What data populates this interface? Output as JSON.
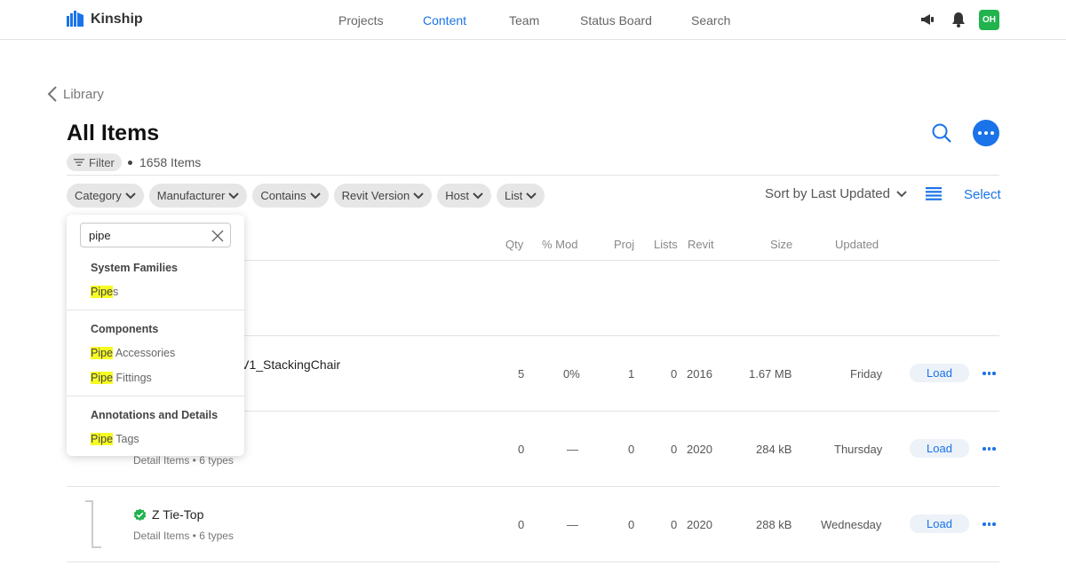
{
  "app": {
    "name": "Kinship"
  },
  "nav": [
    {
      "label": "Projects",
      "active": false
    },
    {
      "label": "Content",
      "active": true
    },
    {
      "label": "Team",
      "active": false
    },
    {
      "label": "Status Board",
      "active": false
    },
    {
      "label": "Search",
      "active": false
    }
  ],
  "user": {
    "initials": "OH",
    "color": "#21b34e"
  },
  "breadcrumb": {
    "back_label": "Library"
  },
  "page": {
    "title": "All Items",
    "filter_label": "Filter",
    "count_text": "1658 Items"
  },
  "chips": [
    "Category",
    "Manufacturer",
    "Contains",
    "Revit Version",
    "Host",
    "List"
  ],
  "sort": {
    "label": "Sort by Last Updated"
  },
  "select_label": "Select",
  "columns": [
    "Qty",
    "% Mod",
    "Proj",
    "Lists",
    "Revit",
    "Size",
    "Updated"
  ],
  "rows": [
    {
      "name": "HV1_StackingChair",
      "subtitle": "",
      "qty": "5",
      "mod": "0%",
      "proj": "1",
      "lists": "0",
      "revit": "2016",
      "size": "1.67 MB",
      "updated": "Friday",
      "action": "Load"
    },
    {
      "name": "",
      "subtitle": "Detail Items • 6 types",
      "qty": "0",
      "mod": "—",
      "proj": "0",
      "lists": "0",
      "revit": "2020",
      "size": "284 kB",
      "updated": "Thursday",
      "action": "Load"
    },
    {
      "name": "Z Tie-Top",
      "subtitle": "Detail Items • 6 types",
      "qty": "0",
      "mod": "—",
      "proj": "0",
      "lists": "0",
      "revit": "2020",
      "size": "288 kB",
      "updated": "Wednesday",
      "action": "Load"
    }
  ],
  "dropdown": {
    "search_value": "pipe",
    "groups": [
      {
        "title": "System Families",
        "options": [
          {
            "match": "Pipe",
            "rest": "s"
          }
        ]
      },
      {
        "title": "Components",
        "options": [
          {
            "match": "Pipe",
            "rest": " Accessories"
          },
          {
            "match": "Pipe",
            "rest": " Fittings"
          }
        ]
      },
      {
        "title": "Annotations and Details",
        "options": [
          {
            "match": "Pipe",
            "rest": " Tags"
          }
        ]
      }
    ]
  },
  "colors": {
    "accent": "#1a73e8",
    "highlight": "#f6fb23",
    "verified": "#21b34e"
  }
}
